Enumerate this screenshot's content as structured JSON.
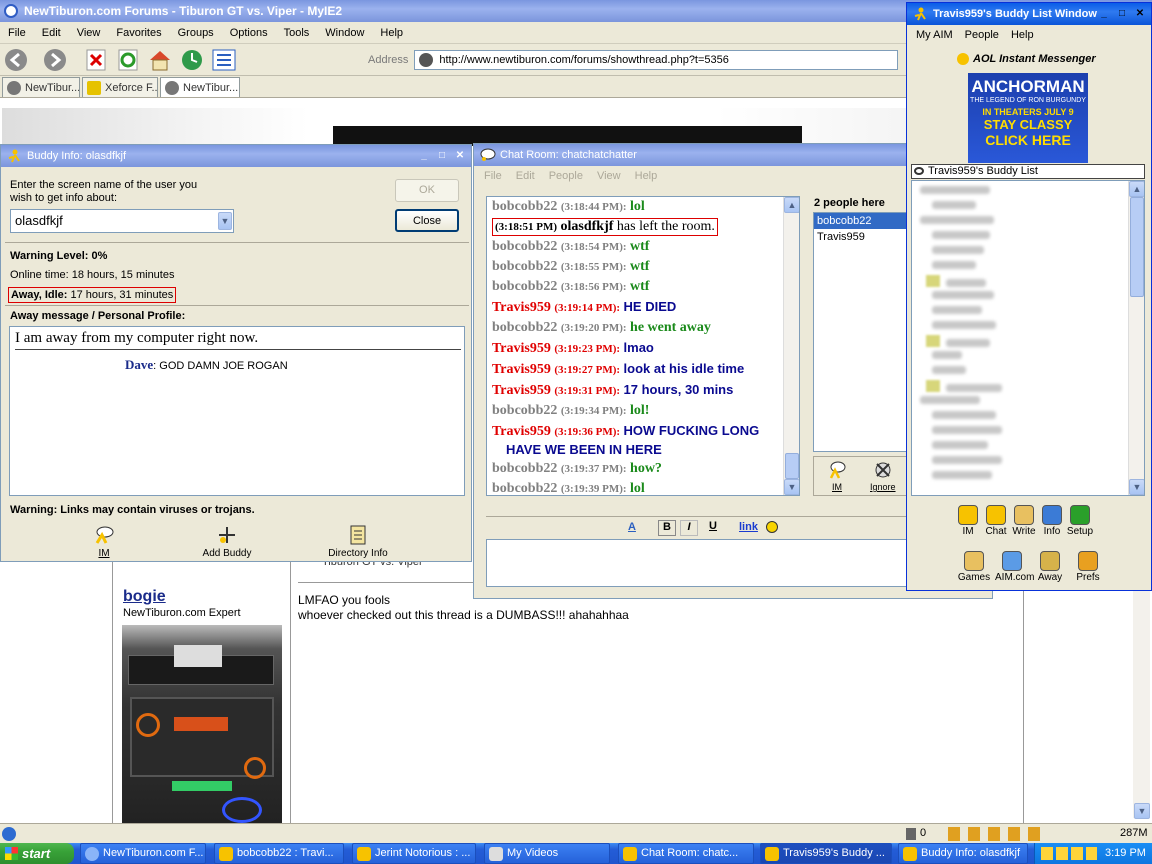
{
  "browser": {
    "title": "NewTiburon.com Forums - Tiburon GT vs. Viper - MyIE2",
    "menu": [
      "File",
      "Edit",
      "View",
      "Favorites",
      "Groups",
      "Options",
      "Tools",
      "Window",
      "Help"
    ],
    "address_label": "Address",
    "address_value": "http://www.newtiburon.com/forums/showthread.php?t=5356",
    "tabs": [
      "NewTibur...",
      "Xeforce F...",
      "NewTibur..."
    ],
    "forum": {
      "username": "bogie",
      "usertitle": "NewTiburon.com Expert",
      "post_title": "Tiburon GT vs. Viper",
      "post_line1": "LMFAO you fools",
      "post_line2": "whoever checked out this thread is a DUMBASS!!! ahahahhaa"
    },
    "status": {
      "popup_count": "0",
      "memory": "287M"
    }
  },
  "buddy_info": {
    "title": "Buddy Info: olasdfkjf",
    "prompt_line1": "Enter the screen name of the user you",
    "prompt_line2": "wish to get info about:",
    "screen_name": "olasdfkjf",
    "ok_label": "OK",
    "close_label": "Close",
    "warning_level": "Warning Level: 0%",
    "online_time": "Online time: 18 hours, 15 minutes",
    "away_label": "Away, Idle:",
    "away_value": "17 hours, 31 minutes",
    "profile_heading": "Away message / Personal Profile:",
    "away_message": "I am away from my computer right now.",
    "profile_name": "Dave",
    "profile_text": "GOD DAMN JOE ROGAN",
    "warning_links": "Warning: Links may contain viruses or trojans.",
    "actions": [
      "IM",
      "Add Buddy",
      "Directory Info"
    ]
  },
  "chat": {
    "title": "Chat Room: chatchatchatter",
    "menu": [
      "File",
      "Edit",
      "People",
      "View",
      "Help"
    ],
    "people_count": "2 people here",
    "people": [
      "bobcobb22",
      "Travis959"
    ],
    "side_buttons": [
      "IM",
      "Ignore"
    ],
    "format_link": "link",
    "lines": [
      {
        "name": "bobcobb22",
        "time": "(3:18:44 PM):",
        "text": "lol",
        "nc": "gray",
        "tc": "green"
      },
      {
        "name": "bobcobb22",
        "time": "(3:18:54 PM):",
        "text": "wtf",
        "nc": "gray",
        "tc": "green"
      },
      {
        "name": "bobcobb22",
        "time": "(3:18:55 PM):",
        "text": "wtf",
        "nc": "gray",
        "tc": "green"
      },
      {
        "name": "bobcobb22",
        "time": "(3:18:56 PM):",
        "text": "wtf",
        "nc": "gray",
        "tc": "green"
      },
      {
        "name": "Travis959",
        "time": "(3:19:14 PM):",
        "text": "HE DIED",
        "nc": "red",
        "tc": "blue"
      },
      {
        "name": "bobcobb22",
        "time": "(3:19:20 PM):",
        "text": "he went away",
        "nc": "gray",
        "tc": "green"
      },
      {
        "name": "Travis959",
        "time": "(3:19:23 PM):",
        "text": "lmao",
        "nc": "red",
        "tc": "blue"
      },
      {
        "name": "Travis959",
        "time": "(3:19:27 PM):",
        "text": "look at his idle time",
        "nc": "red",
        "tc": "blue"
      },
      {
        "name": "Travis959",
        "time": "(3:19:31 PM):",
        "text": "17 hours, 30 mins",
        "nc": "red",
        "tc": "blue"
      },
      {
        "name": "bobcobb22",
        "time": "(3:19:34 PM):",
        "text": "lol!",
        "nc": "gray",
        "tc": "green"
      },
      {
        "name": "Travis959",
        "time": "(3:19:36 PM):",
        "text": "HOW FUCKING LONG",
        "nc": "red",
        "tc": "blue"
      },
      {
        "name": "bobcobb22",
        "time": "(3:19:37 PM):",
        "text": "how?",
        "nc": "gray",
        "tc": "green"
      },
      {
        "name": "bobcobb22",
        "time": "(3:19:39 PM):",
        "text": "lol",
        "nc": "gray",
        "tc": "green"
      }
    ],
    "left_line": {
      "time": "(3:18:51 PM)",
      "name": "olasdfkjf",
      "text": "has left the room."
    },
    "wrap_text": "HAVE WE BEEN IN HERE"
  },
  "buddy_list": {
    "title": "Travis959's Buddy List Window",
    "menu": [
      "My AIM",
      "People",
      "Help"
    ],
    "brand": "AOL Instant Messenger",
    "ad": {
      "line1": "ANCHORMAN",
      "line2": "THE LEGEND OF RON BURGUNDY",
      "line3": "IN THEATERS JULY 9",
      "line4": "STAY CLASSY",
      "line5": "CLICK HERE"
    },
    "list_header": "Travis959's Buddy List",
    "toolbar1": [
      "IM",
      "Chat",
      "Write",
      "Info",
      "Setup"
    ],
    "toolbar2": [
      "Games",
      "AIM.com",
      "Away",
      "Prefs"
    ]
  },
  "taskbar": {
    "start": "start",
    "items": [
      "NewTiburon.com F...",
      "bobcobb22 : Travi...",
      "Jerint Notorious : ...",
      "My Videos",
      "Chat Room: chatc...",
      "Travis959's Buddy ...",
      "Buddy Info: olasdfkjf"
    ],
    "clock": "3:19 PM"
  }
}
